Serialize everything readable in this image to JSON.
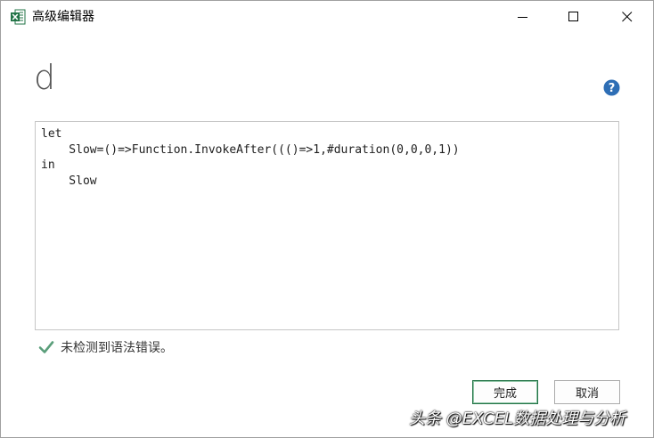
{
  "window": {
    "title": "高级编辑器",
    "app_icon": "excel-icon",
    "controls": [
      "minimize-icon",
      "maximize-icon",
      "close-icon"
    ]
  },
  "query": {
    "name": "d",
    "help_icon": "help-icon"
  },
  "editor": {
    "lines": [
      "let",
      "    Slow=()=>Function.InvokeAfter((()=>1,#duration(0,0,0,1))",
      "in",
      "    Slow"
    ]
  },
  "status": {
    "icon": "check-icon",
    "text": "未检测到语法错误。",
    "color": "#5a9e7a"
  },
  "buttons": {
    "done": "完成",
    "cancel": "取消"
  },
  "watermark": "头条 @EXCEL数据处理与分析",
  "colors": {
    "accent": "#217346",
    "help": "#2e6eb5"
  }
}
